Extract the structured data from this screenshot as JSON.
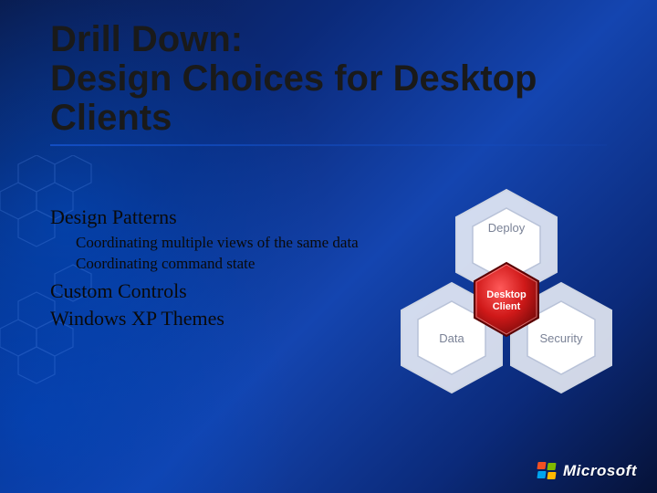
{
  "title": {
    "line1": "Drill Down:",
    "line2": "Design Choices for Desktop Clients"
  },
  "bullets": {
    "design_patterns": "Design Patterns",
    "dp_sub1": "Coordinating multiple views of the same data",
    "dp_sub2": "Coordinating command state",
    "custom_controls": "Custom Controls",
    "xp_themes": "Windows XP Themes"
  },
  "diagram": {
    "top": "Deploy",
    "center": "Desktop Client",
    "bottom_left": "Data",
    "bottom_right": "Security"
  },
  "footer": {
    "logo_text": "Microsoft"
  }
}
